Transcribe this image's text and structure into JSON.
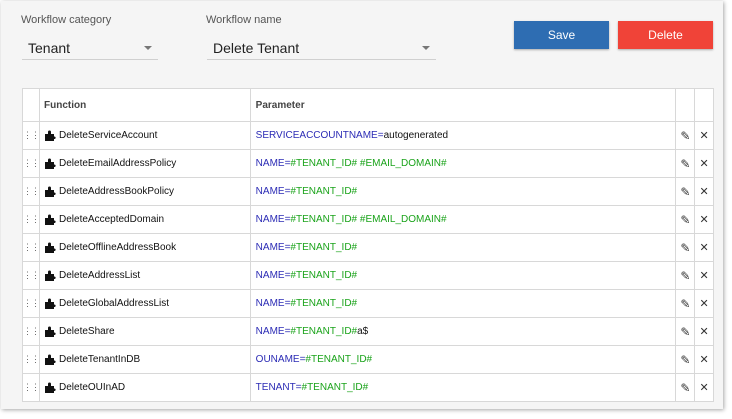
{
  "form": {
    "category_label": "Workflow category",
    "category_value": "Tenant",
    "name_label": "Workflow name",
    "name_value": "Delete Tenant"
  },
  "buttons": {
    "save": "Save",
    "delete": "Delete"
  },
  "table": {
    "headers": {
      "function": "Function",
      "parameter": "Parameter"
    },
    "rows": [
      {
        "function": "DeleteServiceAccount",
        "param_name": "SERVICEACCOUNTNAME",
        "param_value": "",
        "param_tail": "autogenerated"
      },
      {
        "function": "DeleteEmailAddressPolicy",
        "param_name": "NAME",
        "param_value": "#TENANT_ID# #EMAIL_DOMAIN#",
        "param_tail": ""
      },
      {
        "function": "DeleteAddressBookPolicy",
        "param_name": "NAME",
        "param_value": "#TENANT_ID#",
        "param_tail": ""
      },
      {
        "function": "DeleteAcceptedDomain",
        "param_name": "NAME",
        "param_value": "#TENANT_ID# #EMAIL_DOMAIN#",
        "param_tail": ""
      },
      {
        "function": "DeleteOfflineAddressBook",
        "param_name": "NAME",
        "param_value": "#TENANT_ID#",
        "param_tail": ""
      },
      {
        "function": "DeleteAddressList",
        "param_name": "NAME",
        "param_value": "#TENANT_ID#",
        "param_tail": ""
      },
      {
        "function": "DeleteGlobalAddressList",
        "param_name": "NAME",
        "param_value": "#TENANT_ID#",
        "param_tail": ""
      },
      {
        "function": "DeleteShare",
        "param_name": "NAME",
        "param_value": "#TENANT_ID#",
        "param_tail": "a$"
      },
      {
        "function": "DeleteTenantInDB",
        "param_name": "OUNAME",
        "param_value": "#TENANT_ID#",
        "param_tail": ""
      },
      {
        "function": "DeleteOUInAD",
        "param_name": "TENANT",
        "param_value": "#TENANT_ID#",
        "param_tail": ""
      }
    ]
  },
  "icons": {
    "drag": "drag-handle-icon",
    "function": "puzzle-piece-icon",
    "edit": "pencil-icon",
    "remove": "close-icon"
  },
  "colors": {
    "save": "#2e6db2",
    "delete": "#f04338",
    "param_name": "#2b2bb5",
    "param_value": "#1aa31a"
  },
  "symbols": {
    "equals": "=",
    "pencil": "✎",
    "close": "✕"
  }
}
